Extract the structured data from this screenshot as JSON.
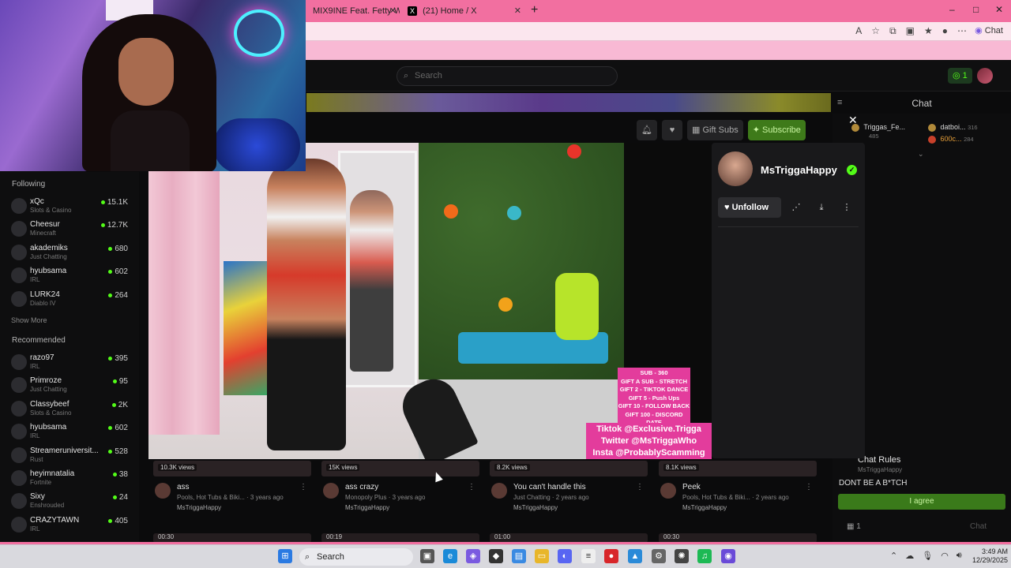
{
  "browser": {
    "tabs": [
      {
        "label": "MIX9INE Feat. Fetty Wap & A"
      },
      {
        "label": "(21) Home / X"
      }
    ],
    "new_tab": "+",
    "copilot_label": "Chat",
    "window_controls": [
      "–",
      "□",
      "✕"
    ]
  },
  "site": {
    "search_placeholder": "Search",
    "online_count": "1"
  },
  "chat": {
    "title": "Chat",
    "gifters": [
      {
        "name": "Triggas_Fe...",
        "amount": "485"
      },
      {
        "name": "datboi...",
        "amount": "316"
      },
      {
        "name": "600c...",
        "amount": "284"
      }
    ],
    "rules_title": "Chat Rules",
    "rules_sub": "MsTriggaHappy",
    "rules_text": "DONT BE A B*TCH",
    "agree_label": "I agree",
    "footer_count": "1",
    "send_label": "Chat"
  },
  "stream_actions": {
    "gift_label": "Gift Subs",
    "subscribe_label": "Subscribe"
  },
  "sidebar": {
    "following_title": "Following",
    "following": [
      {
        "name": "xQc",
        "category": "Slots & Casino",
        "viewers": "15.1K"
      },
      {
        "name": "Cheesur",
        "category": "Minecraft",
        "viewers": "12.7K"
      },
      {
        "name": "akademiks",
        "category": "Just Chatting",
        "viewers": "680"
      },
      {
        "name": "hyubsama",
        "category": "IRL",
        "viewers": "602"
      },
      {
        "name": "LURK24",
        "category": "Diablo IV",
        "viewers": "264"
      }
    ],
    "show_more": "Show More",
    "recommended_title": "Recommended",
    "recommended": [
      {
        "name": "razo97",
        "category": "IRL",
        "viewers": "395"
      },
      {
        "name": "Primroze",
        "category": "Just Chatting",
        "viewers": "95"
      },
      {
        "name": "Classybeef",
        "category": "Slots & Casino",
        "viewers": "2K"
      },
      {
        "name": "hyubsama",
        "category": "IRL",
        "viewers": "602"
      },
      {
        "name": "Streameruniversit...",
        "category": "Rust",
        "viewers": "528"
      },
      {
        "name": "heyimnatalia",
        "category": "Fortnite",
        "viewers": "38"
      },
      {
        "name": "Sixy",
        "category": "Enshrouded",
        "viewers": "24"
      },
      {
        "name": "CRAZYTAWN",
        "category": "IRL",
        "viewers": "405"
      }
    ]
  },
  "video": {
    "sub_goals": [
      "SUB - 360",
      "GIFT A SUB - STRETCH",
      "GIFT 2 - TIKTOK DANCE",
      "GIFT 5 - Push Ups",
      "GIFT 10 - FOLLOW BACK",
      "GIFT 100 - DISCORD DATE"
    ],
    "socials": [
      "Tiktok @Exclusive.Trigga",
      "Twitter @MsTriggaWho",
      "Insta @ProbablyScamming"
    ]
  },
  "profile": {
    "name": "MsTriggaHappy",
    "verified_icon": "✓",
    "unfollow_label": "Unfollow"
  },
  "clips": [
    {
      "views": "10.3K views",
      "title": "ass",
      "meta": "Pools, Hot Tubs & Biki... · 3 years ago",
      "user": "MsTriggaHappy",
      "next": "00:30"
    },
    {
      "views": "15K views",
      "title": "ass crazy",
      "meta": "Monopoly Plus · 3 years ago",
      "user": "MsTriggaHappy",
      "next": "00:19"
    },
    {
      "views": "8.2K views",
      "title": "You can't handle this",
      "meta": "Just Chatting · 2 years ago",
      "user": "MsTriggaHappy",
      "next": "01:00"
    },
    {
      "views": "8.1K views",
      "title": "Peek",
      "meta": "Pools, Hot Tubs & Biki... · 2 years ago",
      "user": "MsTriggaHappy",
      "next": "00:30"
    }
  ],
  "taskbar": {
    "search_label": "Search",
    "time": "3:49 AM",
    "date": "12/29/2025"
  }
}
